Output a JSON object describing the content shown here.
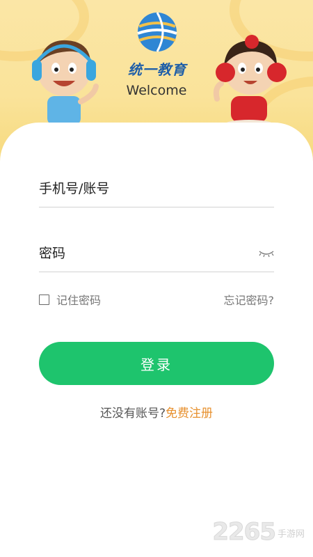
{
  "header": {
    "brand": "统一教育",
    "welcome": "Welcome",
    "logo_icon": "globe-logo-icon",
    "colors": {
      "background": "#fae39a",
      "brand": "#1f5fa8"
    }
  },
  "form": {
    "account_placeholder": "手机号/账号",
    "password_placeholder": "密码",
    "password_toggle_icon": "eye-closed-icon",
    "remember_label": "记住密码",
    "remember_checked": false,
    "forgot_label": "忘记密码?",
    "login_label": "登录",
    "login_color": "#1ec46d"
  },
  "register": {
    "prompt": "还没有账号?",
    "link": "免费注册",
    "link_color": "#e7902e"
  },
  "watermark": {
    "number": "2265",
    "text": "手游网"
  }
}
